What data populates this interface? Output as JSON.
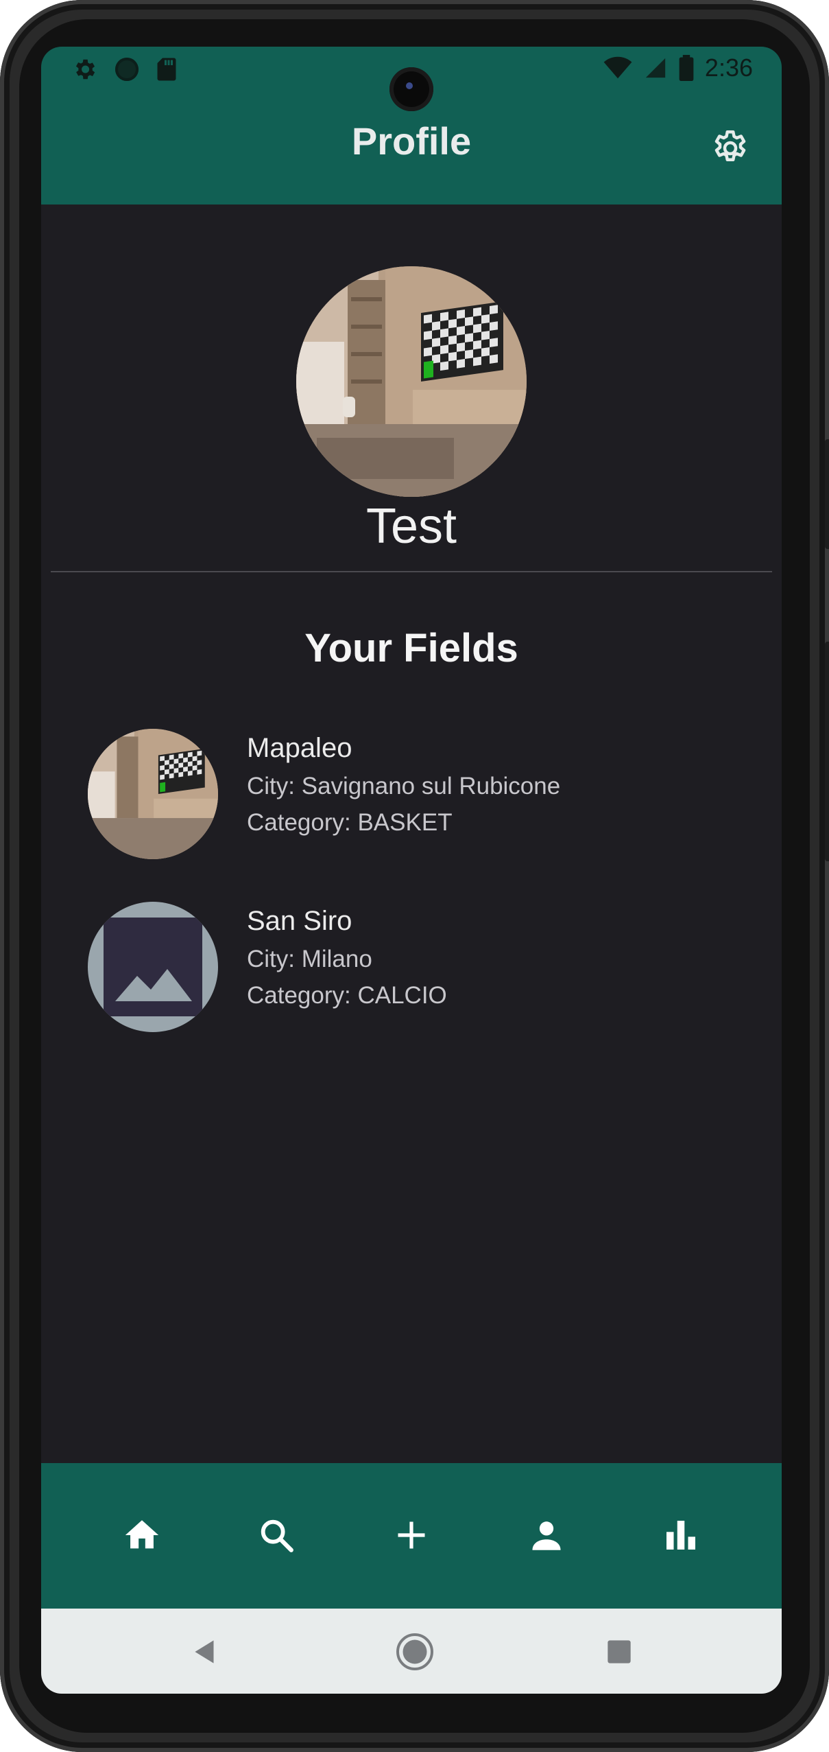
{
  "status_bar": {
    "time": "2:36",
    "left_icons": [
      "settings-icon",
      "circle-icon",
      "sd-card-icon"
    ],
    "right_icons": [
      "wifi-icon",
      "signal-icon",
      "battery-icon"
    ]
  },
  "header": {
    "title": "Profile",
    "settings_icon": "gear-icon"
  },
  "profile": {
    "name": "Test",
    "avatar_description": "room with tv"
  },
  "fields_section": {
    "title": "Your Fields",
    "items": [
      {
        "name": "Mapaleo",
        "city": "City: Savignano sul Rubicone",
        "category": "Category: BASKET",
        "thumbnail": "room-photo"
      },
      {
        "name": "San Siro",
        "city": "City: Milano",
        "category": "Category: CALCIO",
        "thumbnail": "image-placeholder-icon"
      }
    ]
  },
  "bottom_nav": {
    "items": [
      "home-icon",
      "search-icon",
      "add-icon",
      "person-icon",
      "bar-chart-icon"
    ]
  },
  "system_nav": {
    "buttons": [
      "back-button",
      "home-button",
      "recents-button"
    ]
  },
  "colors": {
    "primary": "#116054",
    "background": "#1e1d22",
    "text": "#f2f2f2"
  }
}
